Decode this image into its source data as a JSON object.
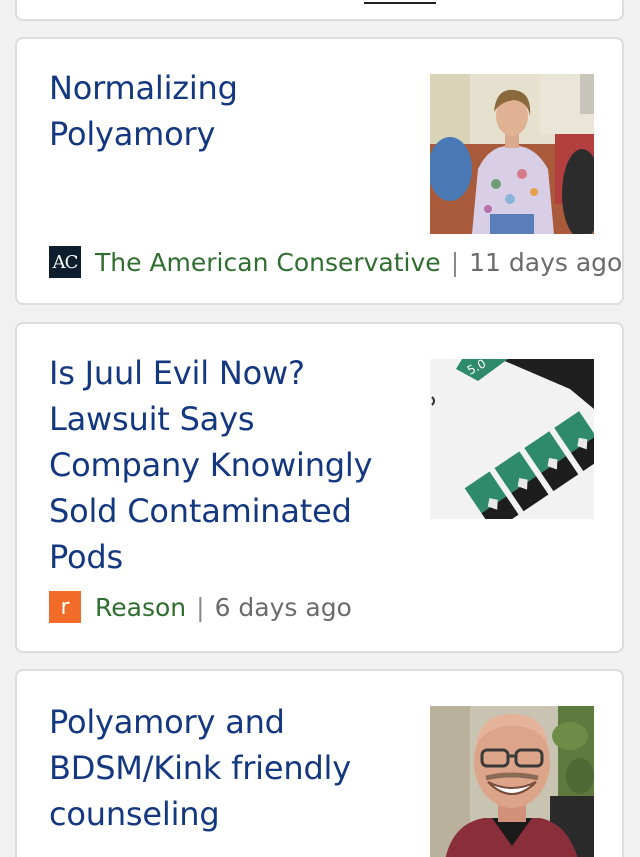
{
  "articles": [
    {
      "title": "Normalizing Polyamory",
      "source": "The American Conservative",
      "source_logo_text": "AC",
      "separator": "|",
      "time": "11 days ago",
      "source_color": "#2f6e2f"
    },
    {
      "title": "Is Juul Evil Now? Lawsuit Says Company Knowingly Sold Contaminated Pods",
      "source": "Reason",
      "source_logo_text": "r",
      "separator": "|",
      "time": "6 days ago",
      "source_color": "#2f6e2f",
      "thumbnail_text": "5.0"
    },
    {
      "title": "Polyamory and BDSM/Kink friendly counseling"
    }
  ],
  "colors": {
    "title": "#14387f",
    "reason_logo": "#f26b29",
    "ac_logo": "#0e1e2e",
    "time": "#6b6b6b"
  }
}
